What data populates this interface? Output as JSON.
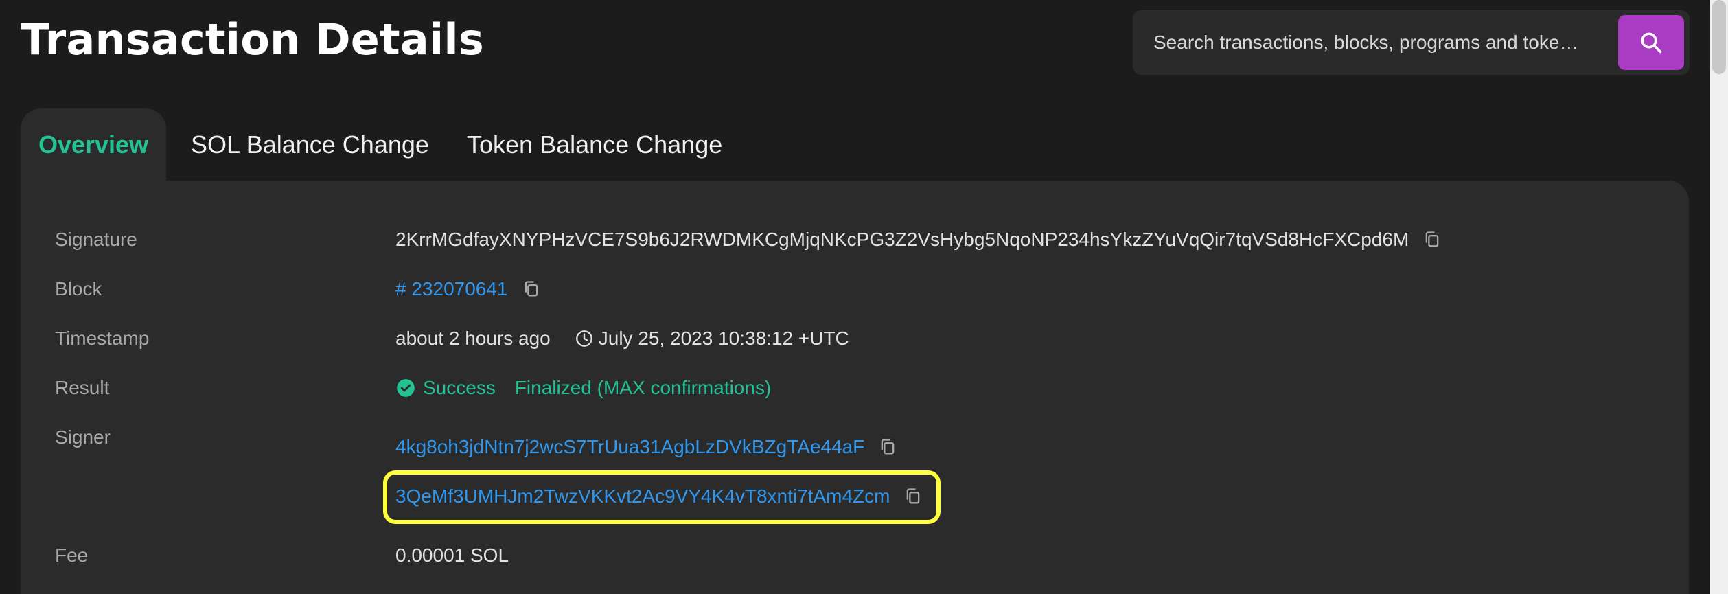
{
  "header": {
    "title": "Transaction Details",
    "search_placeholder": "Search transactions, blocks, programs and toke…"
  },
  "tabs": [
    {
      "label": "Overview",
      "active": true
    },
    {
      "label": "SOL Balance Change",
      "active": false
    },
    {
      "label": "Token Balance Change",
      "active": false
    }
  ],
  "details": {
    "signature": {
      "label": "Signature",
      "value": "2KrrMGdfayXNYPHzVCE7S9b6J2RWDMKCgMjqNKcPG3Z2VsHybg5NqoNP234hsYkzZYuVqQir7tqVSd8HcFXCpd6M"
    },
    "block": {
      "label": "Block",
      "value": "# 232070641"
    },
    "timestamp": {
      "label": "Timestamp",
      "relative": "about 2 hours ago",
      "absolute": "July 25, 2023 10:38:12 +UTC"
    },
    "result": {
      "label": "Result",
      "status": "Success",
      "confirmation": "Finalized (MAX confirmations)"
    },
    "signer": {
      "label": "Signer",
      "values": [
        "4kg8oh3jdNtn7j2wcS7TrUua31AgbLzDVkBZgTAe44aF",
        "3QeMf3UMHJm2TwzVKKvt2Ac9VY4K4vT8xnti7tAm4Zcm"
      ]
    },
    "fee": {
      "label": "Fee",
      "value": "0.00001 SOL"
    }
  },
  "colors": {
    "background": "#1c1c1c",
    "panel": "#2b2b2b",
    "accent_green": "#24c293",
    "link_blue": "#2f97ee",
    "search_button": "#aa3bc3",
    "highlight": "#ffff3d"
  },
  "icons": {
    "search": "search-icon",
    "copy": "copy-icon",
    "clock": "clock-icon",
    "success": "check-circle-icon"
  }
}
